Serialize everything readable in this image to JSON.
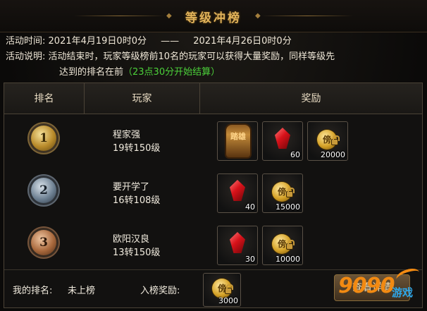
{
  "header": {
    "title": "等级冲榜"
  },
  "info": {
    "time_label": "活动时间:",
    "time_start": "2021年4月19日0时0分",
    "time_sep": "——",
    "time_end": "2021年4月26日0时0分",
    "desc_label": "活动说明:",
    "desc_line1": "活动结束时，玩家等级榜前10名的玩家可以获得大量奖励，同样等级先",
    "desc_line2": "达到的排名在前",
    "desc_note": "（23点30分开始结算）"
  },
  "table": {
    "columns": [
      "排名",
      "玩家",
      "奖励"
    ],
    "rows": [
      {
        "rank": "1",
        "name": "程家强",
        "level": "19转150级",
        "rewards": [
          {
            "icon": "armor-icon",
            "text": "踏雄",
            "count": ""
          },
          {
            "icon": "red-gem-icon",
            "count": "60"
          },
          {
            "icon": "gold-coin-icon",
            "count": "20000"
          }
        ]
      },
      {
        "rank": "2",
        "name": "要开学了",
        "level": "16转108级",
        "rewards": [
          {
            "icon": "red-gem-icon",
            "count": "40"
          },
          {
            "icon": "gold-coin-icon",
            "count": "15000"
          }
        ]
      },
      {
        "rank": "3",
        "name": "欧阳汉良",
        "level": "13转150级",
        "rewards": [
          {
            "icon": "red-gem-icon",
            "count": "30"
          },
          {
            "icon": "gold-coin-icon",
            "count": "10000"
          }
        ]
      }
    ]
  },
  "footer": {
    "my_rank_label": "我的排名:",
    "my_rank_value": "未上榜",
    "entry_reward_label": "入榜奖励:",
    "entry_reward_count": "3000",
    "view_button": "查看详情"
  },
  "watermark": {
    "num": "9090",
    "text": "游戏"
  },
  "colors": {
    "accent": "#e0b25a",
    "note_green": "#4cd23a",
    "watermark_orange": "#f28a12",
    "watermark_blue": "#2ea7ea"
  }
}
